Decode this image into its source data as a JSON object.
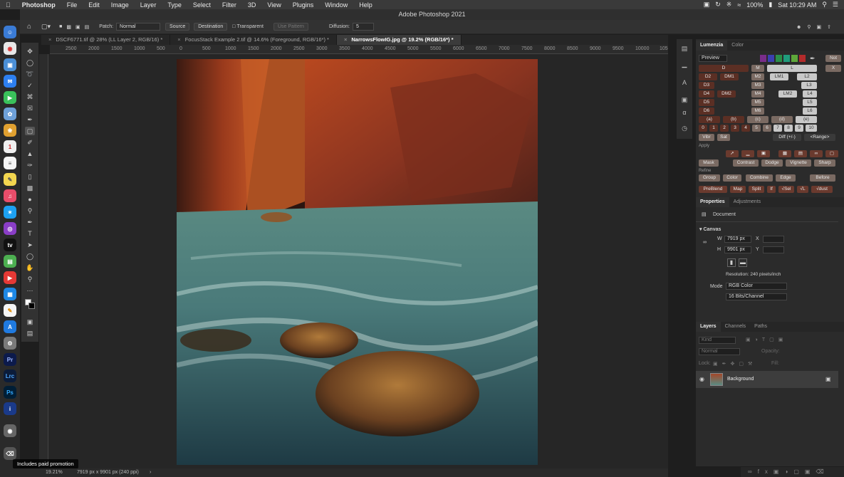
{
  "menubar": {
    "apple": "",
    "app_name": "Photoshop",
    "items": [
      "File",
      "Edit",
      "Image",
      "Layer",
      "Type",
      "Select",
      "Filter",
      "3D",
      "View",
      "Plugins",
      "Window",
      "Help"
    ],
    "battery": "100%",
    "clock": "Sat 10:29 AM"
  },
  "window": {
    "title": "Adobe Photoshop 2021"
  },
  "options_bar": {
    "patch_label": "Patch:",
    "patch_value": "Normal",
    "source_label": "Source",
    "destination_label": "Destination",
    "transparent_label": "Transparent",
    "use_pattern_label": "Use Pattern",
    "diffusion_label": "Diffusion:",
    "diffusion_value": "5"
  },
  "tabs": [
    {
      "label": "DSCF6771.tif @ 28% (LL Layer 2, RGB/16) *",
      "active": false
    },
    {
      "label": "FocusStack Example 2.tif @ 14.6% (Foreground, RGB/16*) *",
      "active": false
    },
    {
      "label": "NarrowsFlowIG.jpg @ 19.2% (RGB/16*) *",
      "active": true
    }
  ],
  "ruler_ticks": [
    "2500",
    "2000",
    "1500",
    "1000",
    "500",
    "0",
    "500",
    "1000",
    "1500",
    "2000",
    "2500",
    "3000",
    "3500",
    "4000",
    "4500",
    "5000",
    "5500",
    "6000",
    "6500",
    "7000",
    "7500",
    "8000",
    "8500",
    "9000",
    "9500",
    "10000",
    "105"
  ],
  "lumenzia": {
    "tab_active": "Lumenzia",
    "tab_other": "Color",
    "preview": "Preview",
    "not": "Not",
    "x": "X",
    "rows": {
      "d": "D",
      "m": "M",
      "l": "L",
      "d2": "D2",
      "dm1": "DM1",
      "m2": "M2",
      "lm1": "LM1",
      "l2": "L2",
      "d3": "D3",
      "m3": "M3",
      "l3": "L3",
      "d4": "D4",
      "dm2": "DM2",
      "m4": "M4",
      "lm2": "LM2",
      "l4": "L4",
      "d5": "D5",
      "m5": "M5",
      "l5": "L5",
      "d6": "D6",
      "m6": "M6",
      "l6": "L6"
    },
    "zones": [
      "(a)",
      "(b)",
      "(c)",
      "(d)",
      "(e)"
    ],
    "numbers": [
      "0",
      "1",
      "2",
      "3",
      "4",
      "5",
      "6",
      "7",
      "8",
      "9",
      "10"
    ],
    "vibr": "Vibr",
    "sat": "Sat",
    "diff": "Diff (+/-)",
    "range": "<Range>",
    "apply_label": "Apply",
    "apply_buttons": [
      "Mask",
      "Contrast",
      "Dodge",
      "Vignette",
      "Sharp"
    ],
    "refine_label": "Refine",
    "refine_buttons": [
      "Group",
      "Color",
      "Combine",
      "Edge",
      "Before"
    ],
    "bottom_buttons": [
      "PreBlend",
      "Map",
      "Split",
      "If",
      "√Sel",
      "√L",
      "√dust"
    ]
  },
  "properties": {
    "tab_active": "Properties",
    "tab_other": "Adjustments",
    "document_label": "Document",
    "canvas_label": "Canvas",
    "w_label": "W",
    "w_value": "7919 px",
    "h_label": "H",
    "h_value": "9901 px",
    "x_label": "X",
    "y_label": "Y",
    "resolution": "Resolution: 240 pixels/inch",
    "mode_label": "Mode",
    "mode_value": "RGB Color",
    "depth_value": "16 Bits/Channel"
  },
  "layers": {
    "tabs": [
      "Layers",
      "Channels",
      "Paths"
    ],
    "kind_placeholder": "Kind",
    "blend_mode": "Normal",
    "opacity_label": "Opacity:",
    "lock_label": "Lock:",
    "fill_label": "Fill:",
    "items": [
      {
        "name": "Background"
      }
    ]
  },
  "status": {
    "zoom": "19.21%",
    "doc_info": "7919 px x 9901 px (240 ppi)"
  },
  "promo": "Includes paid promotion",
  "dock_badges": [
    "Pr",
    "Lrc",
    "Ps"
  ],
  "colors": {
    "accent_swatches": [
      "#7a2d8a",
      "#3b3fb0",
      "#2a8f4a",
      "#1f9c7c",
      "#5ea83a",
      "#b32b2b"
    ]
  }
}
